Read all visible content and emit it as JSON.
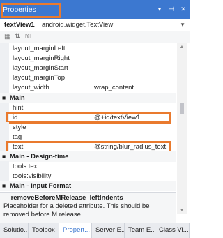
{
  "window": {
    "title": "Properties",
    "controls": [
      {
        "name": "dropdown-icon",
        "glyph": "▾"
      },
      {
        "name": "pin-icon",
        "glyph": "⊣"
      },
      {
        "name": "close-icon",
        "glyph": "✕"
      }
    ]
  },
  "object_bar": {
    "name": "textView1",
    "type": "android.widget.TextView",
    "dropdown_glyph": "▼"
  },
  "toolbar": {
    "icons": [
      {
        "name": "categorized-icon",
        "glyph": "▦"
      },
      {
        "name": "alphabetical-icon",
        "glyph": "⇅"
      },
      {
        "name": "property-pages-icon",
        "glyph": "⚿"
      }
    ]
  },
  "grid": {
    "rows": [
      {
        "kind": "prop",
        "name": "layout_marginLeft",
        "value": ""
      },
      {
        "kind": "prop",
        "name": "layout_marginRight",
        "value": ""
      },
      {
        "kind": "prop",
        "name": "layout_marginStart",
        "value": ""
      },
      {
        "kind": "prop",
        "name": "layout_marginTop",
        "value": ""
      },
      {
        "kind": "prop",
        "name": "layout_width",
        "value": "wrap_content"
      },
      {
        "kind": "cat",
        "toggle": "■",
        "label": "Main"
      },
      {
        "kind": "prop",
        "name": "hint",
        "value": ""
      },
      {
        "kind": "prop",
        "name": "id",
        "value": "@+id/textView1",
        "highlighted": true
      },
      {
        "kind": "prop",
        "name": "style",
        "value": ""
      },
      {
        "kind": "prop",
        "name": "tag",
        "value": ""
      },
      {
        "kind": "prop",
        "name": "text",
        "value": "@string/blur_radius_text",
        "highlighted": true
      },
      {
        "kind": "cat",
        "toggle": "■",
        "label": "Main - Design-time"
      },
      {
        "kind": "prop",
        "name": "tools:text",
        "value": ""
      },
      {
        "kind": "prop",
        "name": "tools:visibility",
        "value": ""
      },
      {
        "kind": "cat",
        "toggle": "■",
        "label": "Main - Input Format"
      }
    ]
  },
  "description": {
    "title": "__removeBeforeMRelease_leftIndents",
    "text": "Placeholder for a deleted attribute. This should be removed before M release."
  },
  "tabs": [
    {
      "label": "Solutio...",
      "active": false
    },
    {
      "label": "Toolbox",
      "active": false
    },
    {
      "label": "Propert...",
      "active": true
    },
    {
      "label": "Server E...",
      "active": false
    },
    {
      "label": "Team E...",
      "active": false
    },
    {
      "label": "Class Vi...",
      "active": false
    }
  ],
  "colors": {
    "accent": "#3c78d0",
    "highlight": "#e97a2e",
    "category_bg": "#f5f6f7"
  }
}
